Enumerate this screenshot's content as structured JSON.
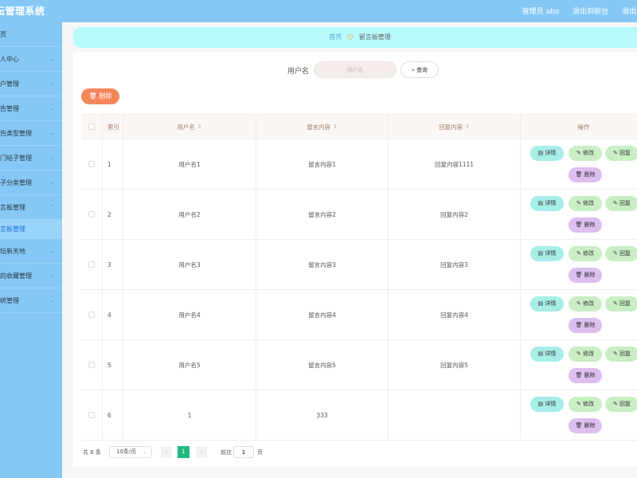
{
  "app": {
    "title": "坛管理系统",
    "admin": "管理员 abo",
    "to_front": "退出到前台",
    "logout": "退出登"
  },
  "sidebar": {
    "items": [
      {
        "label": "页",
        "arrow": ""
      },
      {
        "label": "人中心",
        "arrow": "⌄"
      },
      {
        "label": "户管理",
        "arrow": "⌄"
      },
      {
        "label": "告管理",
        "arrow": "⌄"
      },
      {
        "label": "告类型管理",
        "arrow": "⌄"
      },
      {
        "label": "门帖子管理",
        "arrow": "⌄"
      },
      {
        "label": "子分类管理",
        "arrow": "⌄"
      },
      {
        "label": "言板管理",
        "arrow": "⌃"
      },
      {
        "label": "言板管理",
        "arrow": ""
      },
      {
        "label": "坛新天地",
        "arrow": "⌄"
      },
      {
        "label": "的收藏管理",
        "arrow": "⌄"
      },
      {
        "label": "统管理",
        "arrow": "⌄"
      }
    ]
  },
  "breadcrumb": {
    "home": "首页",
    "current": "留言板管理"
  },
  "search": {
    "label": "用户名",
    "placeholder": "用户名",
    "button": "查询"
  },
  "toolbar": {
    "delete": "删除"
  },
  "table": {
    "headers": {
      "index": "索引",
      "username": "用户名",
      "message": "留言内容",
      "reply": "回复内容",
      "ops": "操作"
    },
    "rows": [
      {
        "index": "1",
        "username": "用户名1",
        "message": "留言内容1",
        "reply": "回复内容1111"
      },
      {
        "index": "2",
        "username": "用户名2",
        "message": "留言内容2",
        "reply": "回复内容2"
      },
      {
        "index": "3",
        "username": "用户名3",
        "message": "留言内容3",
        "reply": "回复内容3"
      },
      {
        "index": "4",
        "username": "用户名4",
        "message": "留言内容4",
        "reply": "回复内容4"
      },
      {
        "index": "5",
        "username": "用户名5",
        "message": "留言内容5",
        "reply": "回复内容5"
      },
      {
        "index": "6",
        "username": "1",
        "message": "333",
        "reply": ""
      }
    ],
    "actions": {
      "detail": "详情",
      "edit": "修改",
      "reply": "回复",
      "delete": "删除"
    }
  },
  "pagination": {
    "total": "共 6 条",
    "page_size": "10条/页",
    "current_page": "1",
    "goto_label": "前往",
    "goto_value": "1",
    "page_unit": "页"
  },
  "colors": {
    "header_bg": "#86c8f5",
    "breadcrumb_bg": "#b7fbfb",
    "delete_btn": "#f4875a",
    "detail_btn": "#a7ede8",
    "edit_btn": "#c9eec4",
    "row_delete_btn": "#dcbeef",
    "active_page": "#1fba7e"
  }
}
